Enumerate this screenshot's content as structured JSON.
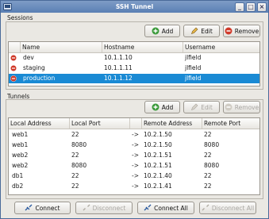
{
  "window": {
    "title": "SSH Tunnel"
  },
  "colors": {
    "selection": "#1a8ad4",
    "titlebar": "#5a7fb4",
    "remove_red": "#d03a2a",
    "add_green": "#3a9a3a"
  },
  "sessions": {
    "label": "Sessions",
    "buttons": {
      "add": "Add",
      "edit": "Edit",
      "remove": "Remove"
    },
    "columns": {
      "name": "Name",
      "hostname": "Hostname",
      "username": "Username"
    },
    "rows": [
      {
        "name": "dev",
        "hostname": "10.1.1.10",
        "username": "jlfield",
        "selected": false
      },
      {
        "name": "staging",
        "hostname": "10.1.1.11",
        "username": "jlfield",
        "selected": false
      },
      {
        "name": "production",
        "hostname": "10.1.1.12",
        "username": "jlfield",
        "selected": true
      }
    ]
  },
  "tunnels": {
    "label": "Tunnels",
    "buttons": {
      "add": "Add",
      "edit": "Edit",
      "remove": "Remove"
    },
    "columns": {
      "local_address": "Local Address",
      "local_port": "Local Port",
      "remote_address": "Remote Address",
      "remote_port": "Remote Port"
    },
    "rows": [
      {
        "local_address": "web1",
        "local_port": "22",
        "arrow": "->",
        "remote_address": "10.2.1.50",
        "remote_port": "22"
      },
      {
        "local_address": "web1",
        "local_port": "8080",
        "arrow": "->",
        "remote_address": "10.2.1.50",
        "remote_port": "8080"
      },
      {
        "local_address": "web2",
        "local_port": "22",
        "arrow": "->",
        "remote_address": "10.2.1.51",
        "remote_port": "22"
      },
      {
        "local_address": "web2",
        "local_port": "8080",
        "arrow": "->",
        "remote_address": "10.2.1.51",
        "remote_port": "8080"
      },
      {
        "local_address": "db1",
        "local_port": "22",
        "arrow": "->",
        "remote_address": "10.2.1.40",
        "remote_port": "22"
      },
      {
        "local_address": "db2",
        "local_port": "22",
        "arrow": "->",
        "remote_address": "10.2.1.41",
        "remote_port": "22"
      }
    ]
  },
  "footer": {
    "connect": "Connect",
    "disconnect": "Disconnect",
    "connect_all": "Connect All",
    "disconnect_all": "Disconnect All"
  }
}
